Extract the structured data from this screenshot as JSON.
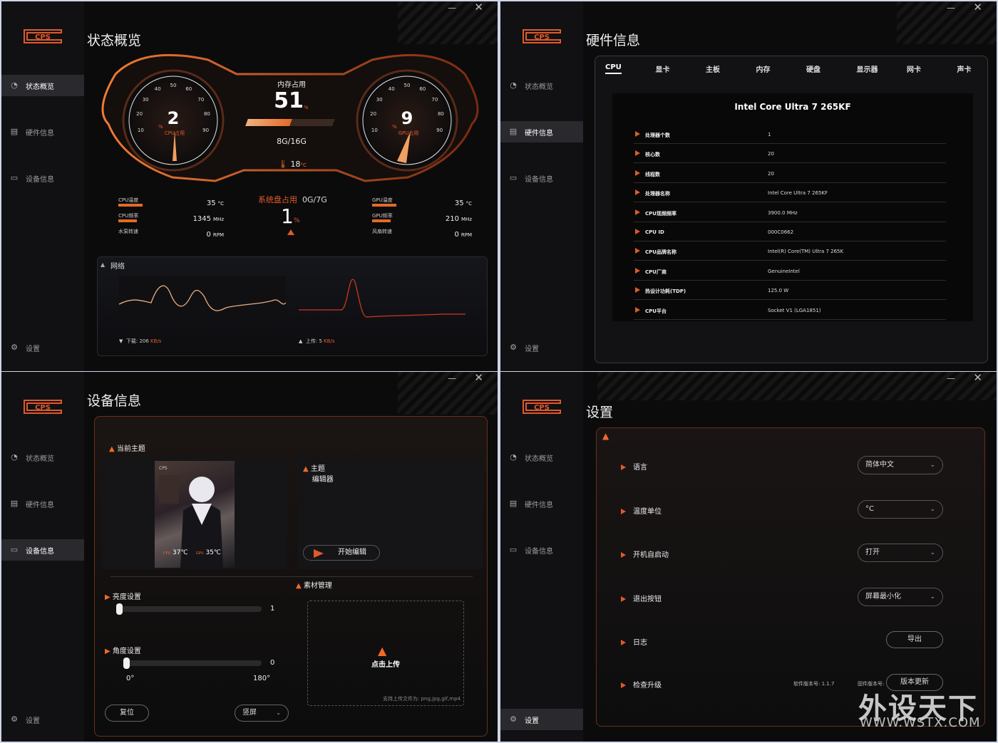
{
  "nav": {
    "overview": "状态概览",
    "hardware": "硬件信息",
    "device": "设备信息",
    "settings": "设置"
  },
  "overview": {
    "title": "状态概览",
    "mem_label": "内存占用",
    "mem_value": "51",
    "mem_pct_unit": "%",
    "mem_fraction": 0.51,
    "mem_size": "8G/16G",
    "temp": "18",
    "temp_unit": "°C",
    "cpu_gauge": {
      "value": "2",
      "unit": "%",
      "label": "CPU占用",
      "ticks": [
        "10",
        "20",
        "30",
        "40",
        "50",
        "60",
        "70",
        "80",
        "90"
      ]
    },
    "gpu_gauge": {
      "value": "9",
      "unit": "%",
      "label": "GPU占用",
      "ticks": [
        "10",
        "20",
        "30",
        "40",
        "50",
        "60",
        "70",
        "80",
        "90"
      ]
    },
    "cpu_stats": [
      {
        "label": "CPU温度",
        "value": "35",
        "unit": "°C"
      },
      {
        "label": "CPU频率",
        "value": "1345",
        "unit": "MHz"
      },
      {
        "label": "水泵转速",
        "value": "0",
        "unit": "RPM"
      }
    ],
    "gpu_stats": [
      {
        "label": "GPU温度",
        "value": "35",
        "unit": "°C"
      },
      {
        "label": "GPU频率",
        "value": "210",
        "unit": "MHz"
      },
      {
        "label": "风扇转速",
        "value": "0",
        "unit": "RPM"
      }
    ],
    "disk_label": "系统盘占用",
    "disk_size": "0G/7G",
    "disk_value": "1",
    "disk_unit": "%",
    "network": {
      "title": "网络",
      "download_label": "下载:",
      "download_value": "206",
      "download_unit": "KB/s",
      "upload_label": "上传:",
      "upload_value": "5",
      "upload_unit": "KB/s"
    }
  },
  "hardware": {
    "title": "硬件信息",
    "tabs": [
      "CPU",
      "显卡",
      "主板",
      "内存",
      "硬盘",
      "显示器",
      "网卡",
      "声卡"
    ],
    "cpu_name": "Intel Core Ultra 7 265KF",
    "rows": [
      {
        "k": "处理器个数",
        "v": "1"
      },
      {
        "k": "核心数",
        "v": "20"
      },
      {
        "k": "线程数",
        "v": "20"
      },
      {
        "k": "处理器名称",
        "v": "Intel Core Ultra 7 265KF"
      },
      {
        "k": "CPU现频频率",
        "v": "3900.0 MHz"
      },
      {
        "k": "CPU ID",
        "v": "000C0662"
      },
      {
        "k": "CPU品牌名称",
        "v": "Intel(R) Core(TM) Ultra 7 265K"
      },
      {
        "k": "CPU厂商",
        "v": "GenuineIntel"
      },
      {
        "k": "热设计功耗(TDP)",
        "v": "125.0 W"
      },
      {
        "k": "CPU平台",
        "v": "Socket V1 (LGA1851)"
      }
    ]
  },
  "device": {
    "title": "设备信息",
    "current_theme": "当前主题",
    "thumb_cpu": "37℃",
    "thumb_gpu": "35℃",
    "thumb_cpu_tag": "CPU",
    "thumb_gpu_tag": "GPU",
    "editor_title1": "主题",
    "editor_title2": "编辑器",
    "editor_button": "开始编辑",
    "assets": "素材管理",
    "brightness": "亮度设置",
    "brightness_value": "1",
    "angle": "角度设置",
    "angle_value": "0",
    "angle_min": "0°",
    "angle_max": "180°",
    "reset": "复位",
    "orientation": "竖屏",
    "upload": "点击上传",
    "upload_hint": "支持上传文件为: png,jpg,gif,mp4"
  },
  "settings": {
    "title": "设置",
    "rows": [
      {
        "label": "语言",
        "value": "简体中文"
      },
      {
        "label": "温度单位",
        "value": "°C"
      },
      {
        "label": "开机自启动",
        "value": "打开"
      },
      {
        "label": "退出按钮",
        "value": "屏幕最小化"
      }
    ],
    "log": "日志",
    "export": "导出",
    "upgrade": "检查升级",
    "sw_version": "软件版本号: 1.1.7",
    "fw_version": "固件版本号:",
    "update_btn": "版本更新"
  },
  "window_controls": {
    "min": "—",
    "close": "✕"
  },
  "watermark": {
    "cn": "外设天下",
    "en": "WWW.WSTX.COM"
  },
  "colors": {
    "accent": "#e56a25",
    "bg": "#0b0b0c",
    "sidebar": "#111113"
  }
}
